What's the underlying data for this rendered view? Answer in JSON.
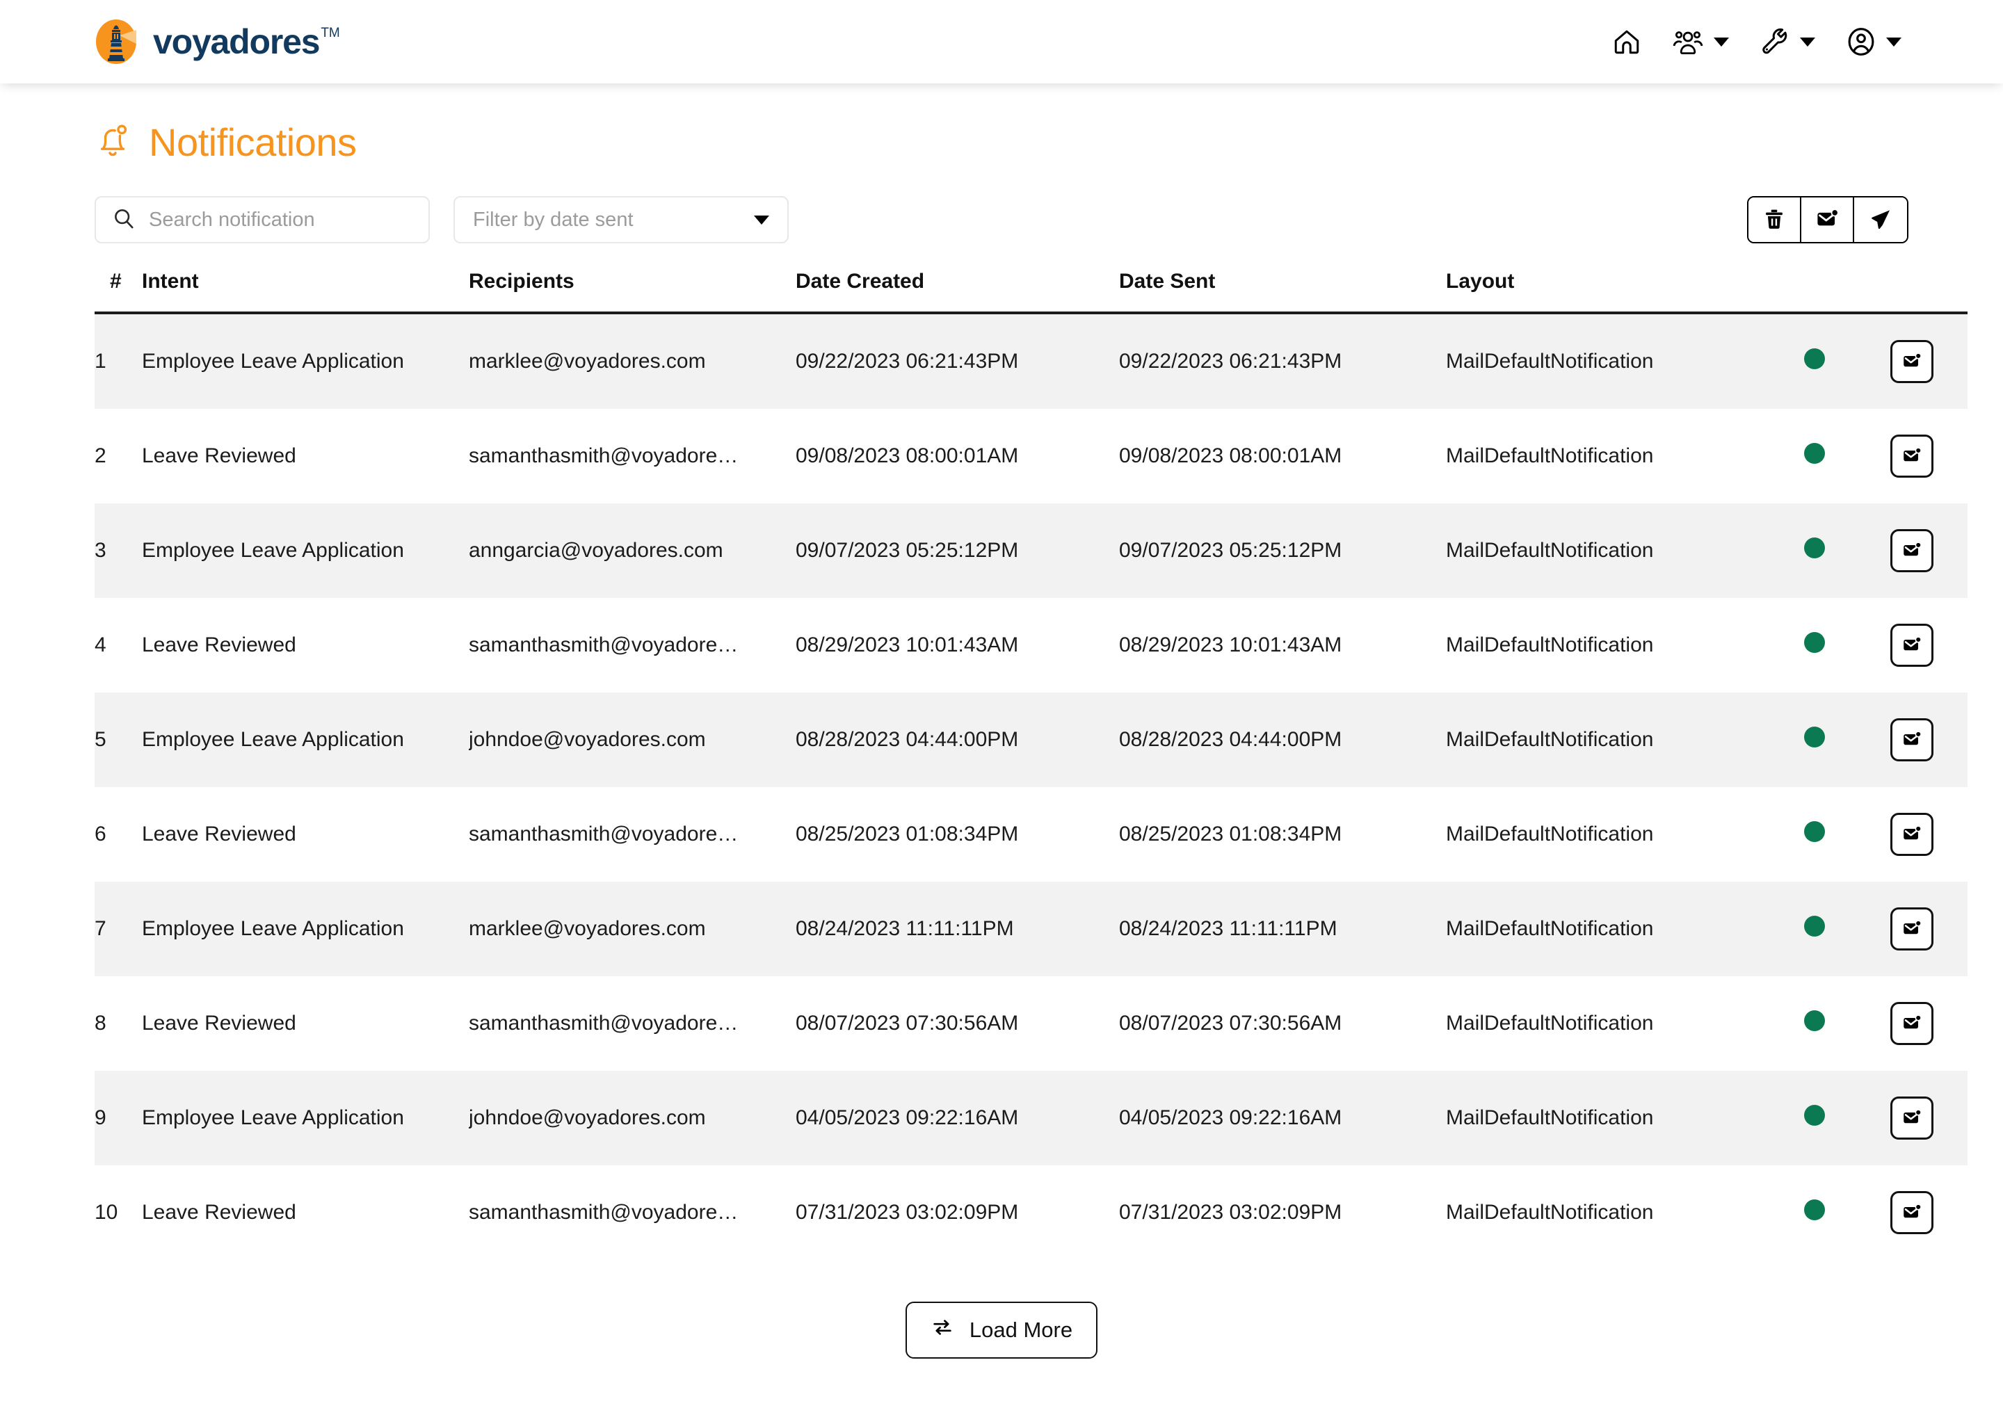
{
  "brand": {
    "name": "voyadores",
    "trademark": "TM",
    "logo_icon": "lighthouse-logo-icon",
    "logo_bg_color": "#F7941E",
    "logo_fg_color": "#123a5e",
    "name_color": "#123a5e"
  },
  "nav": {
    "items": [
      {
        "name": "home-icon",
        "label": "Home",
        "has_caret": false
      },
      {
        "name": "people-icon",
        "label": "People",
        "has_caret": true
      },
      {
        "name": "wrench-icon",
        "label": "Tools",
        "has_caret": true
      },
      {
        "name": "account-icon",
        "label": "Account",
        "has_caret": true
      }
    ]
  },
  "page": {
    "title": "Notifications",
    "title_icon": "bell-icon",
    "title_color": "#F7941E"
  },
  "toolbar": {
    "search": {
      "icon": "search-icon",
      "placeholder": "Search notification",
      "value": ""
    },
    "filter": {
      "label": "Filter by date sent",
      "icon": "chevron-down-icon",
      "selected": ""
    },
    "actions": [
      {
        "name": "delete-button",
        "icon": "trash-icon",
        "label": "Delete"
      },
      {
        "name": "mark-unread-button",
        "icon": "envelope-dot-icon",
        "label": "Mark as unread"
      },
      {
        "name": "send-button",
        "icon": "paper-plane-icon",
        "label": "Send"
      }
    ]
  },
  "table": {
    "columns": [
      "#",
      "Intent",
      "Recipients",
      "Date Created",
      "Date Sent",
      "Layout"
    ],
    "status_color": "#0B7A52",
    "row_action_icon": "envelope-dot-icon",
    "rows": [
      {
        "num": "1",
        "intent": "Employee Leave Application",
        "recipients": "marklee@voyadores.com",
        "date_created": "09/22/2023 06:21:43PM",
        "date_sent": "09/22/2023 06:21:43PM",
        "layout": "MailDefaultNotification"
      },
      {
        "num": "2",
        "intent": "Leave Reviewed",
        "recipients": "samanthasmith@voyadore…",
        "date_created": "09/08/2023 08:00:01AM",
        "date_sent": "09/08/2023 08:00:01AM",
        "layout": "MailDefaultNotification"
      },
      {
        "num": "3",
        "intent": "Employee Leave Application",
        "recipients": "anngarcia@voyadores.com",
        "date_created": "09/07/2023 05:25:12PM",
        "date_sent": "09/07/2023 05:25:12PM",
        "layout": "MailDefaultNotification"
      },
      {
        "num": "4",
        "intent": "Leave Reviewed",
        "recipients": "samanthasmith@voyadore…",
        "date_created": "08/29/2023 10:01:43AM",
        "date_sent": "08/29/2023 10:01:43AM",
        "layout": "MailDefaultNotification"
      },
      {
        "num": "5",
        "intent": "Employee Leave Application",
        "recipients": "johndoe@voyadores.com",
        "date_created": "08/28/2023 04:44:00PM",
        "date_sent": "08/28/2023 04:44:00PM",
        "layout": "MailDefaultNotification"
      },
      {
        "num": "6",
        "intent": "Leave Reviewed",
        "recipients": "samanthasmith@voyadore…",
        "date_created": "08/25/2023 01:08:34PM",
        "date_sent": "08/25/2023 01:08:34PM",
        "layout": "MailDefaultNotification"
      },
      {
        "num": "7",
        "intent": "Employee Leave Application",
        "recipients": "marklee@voyadores.com",
        "date_created": "08/24/2023 11:11:11PM",
        "date_sent": "08/24/2023 11:11:11PM",
        "layout": "MailDefaultNotification"
      },
      {
        "num": "8",
        "intent": "Leave Reviewed",
        "recipients": "samanthasmith@voyadore…",
        "date_created": "08/07/2023 07:30:56AM",
        "date_sent": "08/07/2023 07:30:56AM",
        "layout": "MailDefaultNotification"
      },
      {
        "num": "9",
        "intent": "Employee Leave Application",
        "recipients": "johndoe@voyadores.com",
        "date_created": "04/05/2023 09:22:16AM",
        "date_sent": "04/05/2023 09:22:16AM",
        "layout": "MailDefaultNotification"
      },
      {
        "num": "10",
        "intent": "Leave Reviewed",
        "recipients": "samanthasmith@voyadore…",
        "date_created": "07/31/2023 03:02:09PM",
        "date_sent": "07/31/2023 03:02:09PM",
        "layout": "MailDefaultNotification"
      }
    ]
  },
  "load_more": {
    "label": "Load More",
    "icon": "repeat-arrows-icon"
  }
}
